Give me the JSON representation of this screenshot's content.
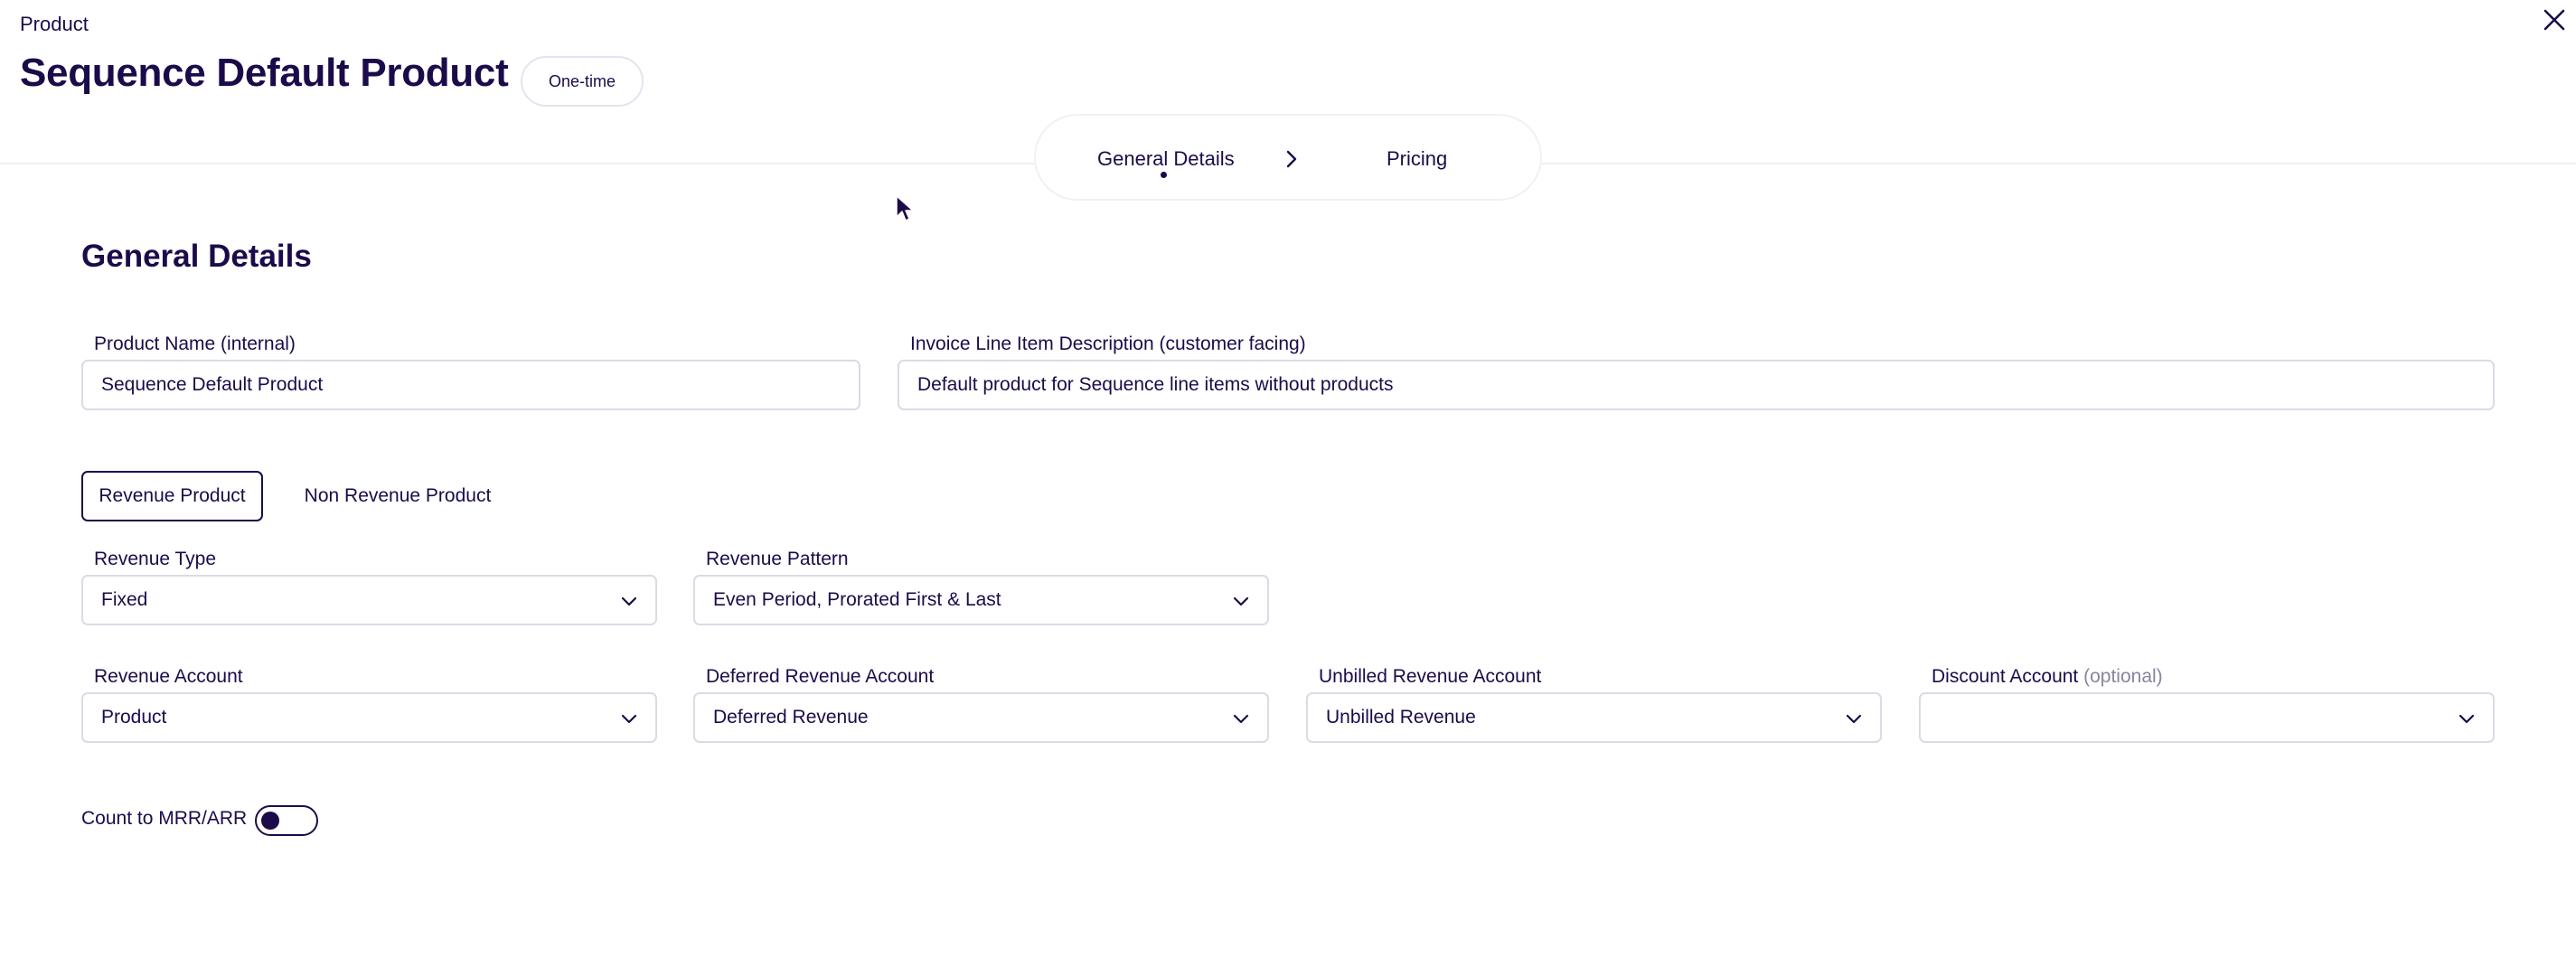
{
  "header": {
    "eyebrow": "Product",
    "title": "Sequence Default Product",
    "type_badge": "One-time"
  },
  "stepper": {
    "steps": [
      {
        "label": "General Details",
        "active": true
      },
      {
        "label": "Pricing",
        "active": false
      }
    ]
  },
  "general": {
    "section_title": "General Details",
    "product_name": {
      "label": "Product Name (internal)",
      "value": "Sequence Default Product"
    },
    "invoice_description": {
      "label": "Invoice Line Item Description (customer facing)",
      "value": "Default product for Sequence line items without products"
    },
    "revenue_toggle": {
      "options": [
        "Revenue Product",
        "Non Revenue Product"
      ],
      "selected": "Revenue Product"
    },
    "revenue_type": {
      "label": "Revenue Type",
      "value": "Fixed"
    },
    "revenue_pattern": {
      "label": "Revenue Pattern",
      "value": "Even Period, Prorated First & Last"
    },
    "revenue_account": {
      "label": "Revenue Account",
      "value": "Product"
    },
    "deferred_revenue_account": {
      "label": "Deferred Revenue Account",
      "value": "Deferred Revenue"
    },
    "unbilled_revenue_account": {
      "label": "Unbilled Revenue Account",
      "value": "Unbilled Revenue"
    },
    "discount_account": {
      "label": "Discount Account",
      "optional_label": "(optional)",
      "value": ""
    },
    "mrr_arr": {
      "label": "Count to MRR/ARR",
      "enabled": false
    }
  },
  "icons": {
    "close": "close-icon",
    "step_separator": "chevron-right-icon",
    "select_arrow": "chevron-down-icon",
    "cursor": "mouse-pointer-icon"
  },
  "colors": {
    "primary": "#1c0b4a",
    "border": "#dcdae5",
    "muted": "#8a849e"
  }
}
